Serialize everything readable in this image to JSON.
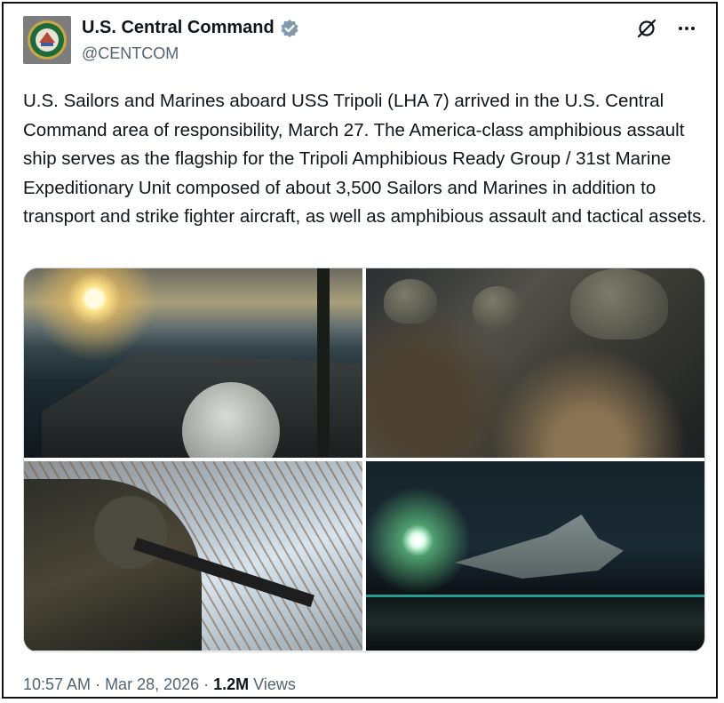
{
  "account": {
    "name": "U.S. Central Command",
    "handle": "@CENTCOM",
    "verified_color": "#829aab"
  },
  "icons": {
    "grok": "grok-icon",
    "more": "more-icon",
    "verified": "verified-badge-icon"
  },
  "post": {
    "text": "U.S. Sailors and Marines aboard USS Tripoli (LHA 7) arrived in the U.S. Central Command area of responsibility, March 27. The America-class amphibious assault ship serves as the flagship for the Tripoli Amphibious Ready Group / 31st Marine Expeditionary Unit composed of about 3,500 Sailors and Marines in addition to transport and strike fighter aircraft, as well as amphibious assault and tactical assets."
  },
  "footer": {
    "time": "10:57 AM",
    "sep1": " · ",
    "date": "Mar 28, 2026",
    "sep2": " · ",
    "views_count": "1.2M",
    "views_label": " Views"
  }
}
